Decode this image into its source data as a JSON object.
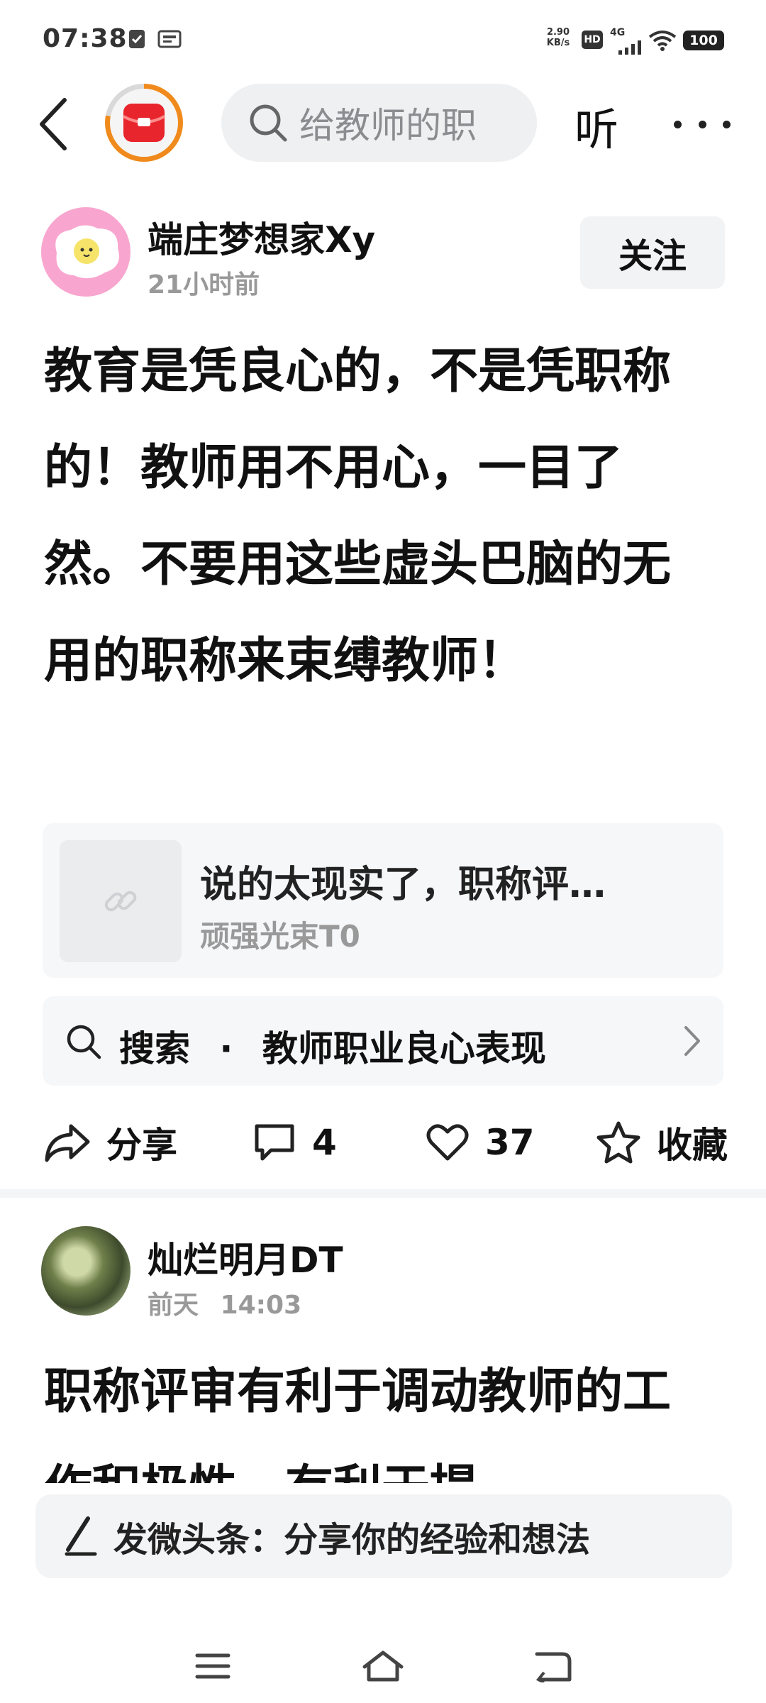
{
  "status_bar": {
    "time": "07:38",
    "net_speed_value": "2.90",
    "net_speed_unit": "KB/s",
    "hd_badge": "HD",
    "network": "4G",
    "battery": "100",
    "icons": [
      "check-shield-icon",
      "news-app-icon",
      "signal-icon",
      "wifi-icon"
    ]
  },
  "top_nav": {
    "search_placeholder": "给教师的职",
    "listen_label": "听"
  },
  "post1": {
    "author": "端庄梦想家Xy",
    "time": "21小时前",
    "follow_label": "关注",
    "body": "教育是凭良心的，不是凭职称的！教师用不用心，一目了然。不要用这些虚头巴脑的无用的职称来束缚教师！",
    "link_card": {
      "title": "说的太现实了，职称评…",
      "author": "顽强光束T0"
    },
    "search_suggest": {
      "label": "搜索",
      "separator": "·",
      "query": "教师职业良心表现"
    },
    "actions": {
      "share": "分享",
      "comments": "4",
      "likes": "37",
      "favorite": "收藏"
    }
  },
  "post2": {
    "author": "灿烂明月DT",
    "date": "前天",
    "time": "14:03",
    "body": "职称评审有利于调动教师的工作积极性，有利于提"
  },
  "composer": {
    "placeholder": "发微头条：分享你的经验和想法"
  },
  "colors": {
    "accent_orange": "#f08a1c",
    "avatar_pink": "#f8a6cf",
    "muted_text": "#999999",
    "card_bg": "#f6f7f9"
  }
}
